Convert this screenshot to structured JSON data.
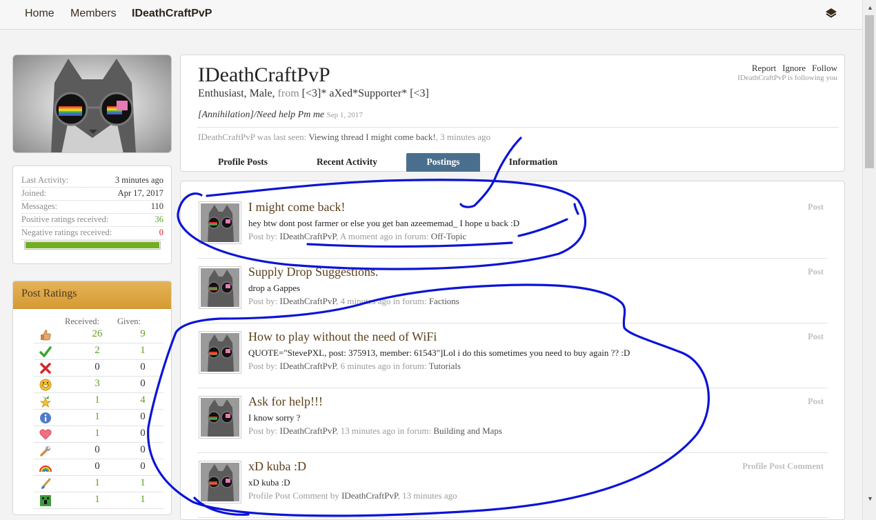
{
  "nav": {
    "home": "Home",
    "members": "Members",
    "current": "IDeathCraftPvP"
  },
  "stats": [
    {
      "label": "Last Activity:",
      "value": "3 minutes ago",
      "tone": ""
    },
    {
      "label": "Joined:",
      "value": "Apr 17, 2017",
      "tone": ""
    },
    {
      "label": "Messages:",
      "value": "110",
      "tone": ""
    },
    {
      "label": "Positive ratings received:",
      "value": "36",
      "tone": "pos"
    },
    {
      "label": "Negative ratings received:",
      "value": "0",
      "tone": "neg"
    }
  ],
  "rating_bar_fraction": 1.0,
  "ratings": {
    "title": "Post Ratings",
    "received_label": "Received:",
    "given_label": "Given:",
    "rows": [
      {
        "icon": "thumbs-up-icon",
        "received": "26",
        "given": "9"
      },
      {
        "icon": "check-icon",
        "received": "2",
        "given": "1"
      },
      {
        "icon": "cross-icon",
        "received": "0",
        "given": "0"
      },
      {
        "icon": "funny-face-icon",
        "received": "3",
        "given": "0"
      },
      {
        "icon": "star-badge-icon",
        "received": "1",
        "given": "4"
      },
      {
        "icon": "info-icon",
        "received": "1",
        "given": "0"
      },
      {
        "icon": "heart-icon",
        "received": "1",
        "given": "0"
      },
      {
        "icon": "wrench-icon",
        "received": "0",
        "given": "0"
      },
      {
        "icon": "rainbow-icon",
        "received": "0",
        "given": "0"
      },
      {
        "icon": "paintbrush-icon",
        "received": "1",
        "given": "1"
      },
      {
        "icon": "creeper-icon",
        "received": "1",
        "given": "1"
      }
    ]
  },
  "profile": {
    "username": "IDeathCraftPvP",
    "blurb_a": "Enthusiast, Male, ",
    "blurb_from": "from",
    "blurb_b": " [<3]* aXed*Supporter* [<3]",
    "status": "[Annihilation]/Need help Pm me",
    "status_date": "Sep 1, 2017",
    "last_seen_prefix": "IDeathCraftPvP was last seen: ",
    "last_seen_activity": "Viewing thread I might come back!",
    "last_seen_time": ", 3 minutes ago",
    "report": "Report",
    "ignore": "Ignore",
    "follow": "Follow",
    "following": "IDeathCraftPvP is following you"
  },
  "tabs": [
    "Profile Posts",
    "Recent Activity",
    "Postings",
    "Information"
  ],
  "active_tab": "Postings",
  "postings": [
    {
      "title": "I might come back!",
      "snippet": "hey btw dont post farmer or else you get ban azeememad_ I hope u back :D",
      "by_prefix": "Post by: ",
      "author": "IDeathCraftPvP",
      "time": ", A moment ago in forum: ",
      "forum": "Off-Topic",
      "type": "Post"
    },
    {
      "title": "Supply Drop Suggestions.",
      "snippet": "drop a Gappes",
      "by_prefix": "Post by: ",
      "author": "IDeathCraftPvP",
      "time": ", 4 minutes ago in forum: ",
      "forum": "Factions",
      "type": "Post"
    },
    {
      "title": "How to play without the need of WiFi",
      "snippet": "QUOTE=\"StevePXL, post: 375913, member: 61543\"]Lol i do this sometimes you need to buy again ?? :D",
      "by_prefix": "Post by: ",
      "author": "IDeathCraftPvP",
      "time": ", 6 minutes ago in forum: ",
      "forum": "Tutorials",
      "type": "Post"
    },
    {
      "title": "Ask for help!!!",
      "snippet": "I know sorry ?",
      "by_prefix": "Post by: ",
      "author": "IDeathCraftPvP",
      "time": ", 13 minutes ago in forum: ",
      "forum": "Building and Maps",
      "type": "Post"
    },
    {
      "title": "xD kuba :D",
      "snippet": "xD kuba :D",
      "by_prefix": "Profile Post Comment by ",
      "author": "IDeathCraftPvP",
      "time": ", 13 minutes ago",
      "forum": "",
      "type": "Profile Post Comment"
    }
  ],
  "colors": {
    "accent_tab": "#4a6f8e",
    "ratings_header": "#d9a23a",
    "positive": "#5aa321",
    "negative": "#d41c1c",
    "scribble": "#0a14d6"
  }
}
